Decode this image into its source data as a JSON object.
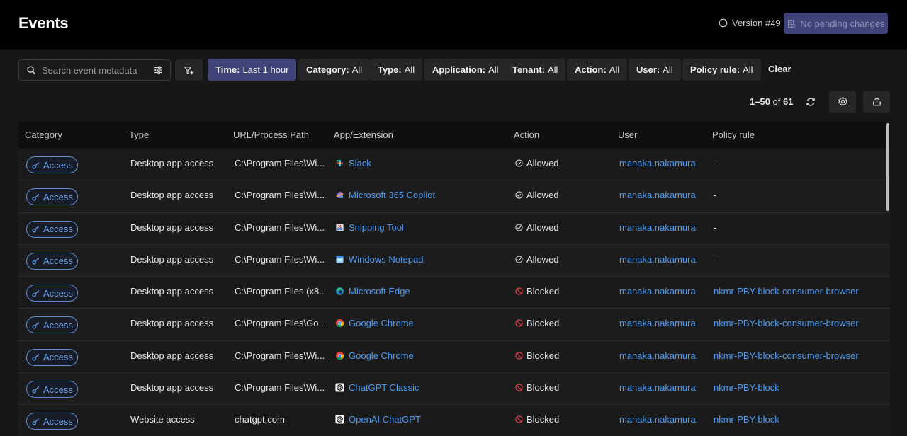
{
  "header": {
    "title": "Events",
    "version": "Version #49",
    "pending_button": "No pending changes"
  },
  "toolbar": {
    "search_placeholder": "Search event metadata",
    "filters": [
      {
        "key": "Time:",
        "value": "Last 1 hour",
        "active": true
      },
      {
        "key": "Category:",
        "value": "All"
      },
      {
        "key": "Type:",
        "value": "All"
      },
      {
        "key": "Application:",
        "value": "All"
      },
      {
        "key": "Tenant:",
        "value": "All"
      },
      {
        "key": "Action:",
        "value": "All"
      },
      {
        "key": "User:",
        "value": "All"
      },
      {
        "key": "Policy rule:",
        "value": "All"
      }
    ],
    "clear_label": "Clear"
  },
  "pagination": {
    "range": "1–50",
    "of": "of",
    "total": "61"
  },
  "table": {
    "columns": [
      "Category",
      "Type",
      "URL/Process Path",
      "App/Extension",
      "Action",
      "User",
      "Policy rule"
    ],
    "rows": [
      {
        "category": "Access",
        "type": "Desktop app access",
        "path": "C:\\Program Files\\Wi...",
        "app": "Slack",
        "app_icon": "slack-icon",
        "action": "Allowed",
        "user": "manaka.nakamura...",
        "policy": "-"
      },
      {
        "category": "Access",
        "type": "Desktop app access",
        "path": "C:\\Program Files\\Wi...",
        "app": "Microsoft 365 Copilot",
        "app_icon": "copilot-icon",
        "action": "Allowed",
        "user": "manaka.nakamura...",
        "policy": "-"
      },
      {
        "category": "Access",
        "type": "Desktop app access",
        "path": "C:\\Program Files\\Wi...",
        "app": "Snipping Tool",
        "app_icon": "snipping-tool-icon",
        "action": "Allowed",
        "user": "manaka.nakamura...",
        "policy": "-"
      },
      {
        "category": "Access",
        "type": "Desktop app access",
        "path": "C:\\Program Files\\Wi...",
        "app": "Windows Notepad",
        "app_icon": "notepad-icon",
        "action": "Allowed",
        "user": "manaka.nakamura...",
        "policy": "-"
      },
      {
        "category": "Access",
        "type": "Desktop app access",
        "path": "C:\\Program Files (x8...",
        "app": "Microsoft Edge",
        "app_icon": "edge-icon",
        "action": "Blocked",
        "user": "manaka.nakamura...",
        "policy": "nkmr-PBY-block-consumer-browser"
      },
      {
        "category": "Access",
        "type": "Desktop app access",
        "path": "C:\\Program Files\\Go...",
        "app": "Google Chrome",
        "app_icon": "chrome-icon",
        "action": "Blocked",
        "user": "manaka.nakamura...",
        "policy": "nkmr-PBY-block-consumer-browser"
      },
      {
        "category": "Access",
        "type": "Desktop app access",
        "path": "C:\\Program Files\\Wi...",
        "app": "Google Chrome",
        "app_icon": "chrome-icon",
        "action": "Blocked",
        "user": "manaka.nakamura...",
        "policy": "nkmr-PBY-block-consumer-browser"
      },
      {
        "category": "Access",
        "type": "Desktop app access",
        "path": "C:\\Program Files\\Wi...",
        "app": "ChatGPT Classic",
        "app_icon": "openai-icon",
        "action": "Blocked",
        "user": "manaka.nakamura...",
        "policy": "nkmr-PBY-block"
      },
      {
        "category": "Access",
        "type": "Website access",
        "path": "chatgpt.com",
        "app": "OpenAI ChatGPT",
        "app_icon": "openai-icon",
        "action": "Blocked",
        "user": "manaka.nakamura...",
        "policy": "nkmr-PBY-block"
      }
    ]
  },
  "colors": {
    "accent": "#3e4478",
    "link": "#4f9df5",
    "allowed": "#d9d9d9",
    "blocked": "#e5484d"
  }
}
